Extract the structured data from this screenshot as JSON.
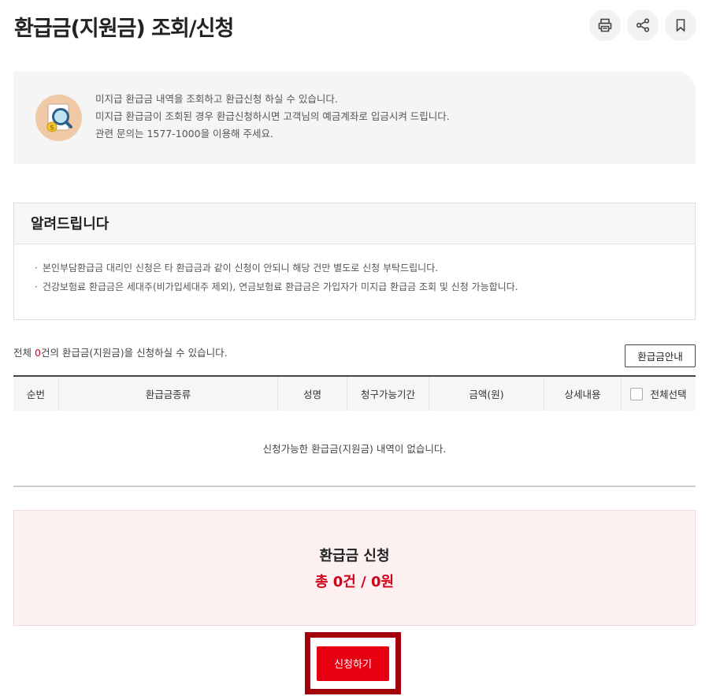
{
  "page": {
    "title": "환급금(지원금) 조회/신청"
  },
  "actions": {
    "print_icon": "print-icon",
    "share_icon": "share-icon",
    "bookmark_icon": "bookmark-icon"
  },
  "intro": {
    "icon": "magnifier-coin-icon",
    "lines": [
      "미지급 환급금 내역을 조회하고 환급신청 하실 수 있습니다.",
      "미지급 환급금이 조회된 경우 환급신청하시면 고객님의 예금계좌로 입금시켜 드립니다.",
      "관련 문의는 1577-1000을 이용해 주세요."
    ]
  },
  "notice": {
    "title": "알려드립니다",
    "items": [
      "본인부담환급금 대리인 신청은 타 환급금과 같이 신청이 안되니 해당 건만 별도로 신청 부탁드립니다.",
      "건강보험료 환급금은 세대주(비가입세대주 제외), 연금보험료 환급금은 가입자가 미지급 환급금 조회 및 신청 가능합니다."
    ]
  },
  "list": {
    "count_prefix": "전체 ",
    "count": "0",
    "count_suffix": "건의 환급금(지원금)을 신청하실 수 있습니다.",
    "guide_button": "환급금안내",
    "columns": [
      "순번",
      "환급금종류",
      "성명",
      "청구가능기간",
      "금액(원)",
      "상세내용",
      "전체선택"
    ],
    "empty_message": "신청가능한 환급금(지원금) 내역이 없습니다."
  },
  "summary": {
    "title": "환급금 신청",
    "total": "총 0건 / 0원"
  },
  "apply_button": "신청하기",
  "colors": {
    "accent_red": "#e60012",
    "highlight_frame": "#a3000c",
    "summary_bg": "#fdf0f0"
  }
}
